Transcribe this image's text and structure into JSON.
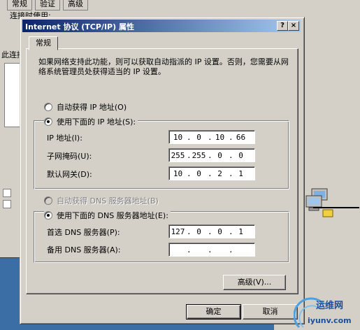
{
  "background_window": {
    "tabs": [
      "常规",
      "验证",
      "高级"
    ],
    "label_connect": "连接时使用:",
    "label_items": "此连接使用下列项目"
  },
  "dialog": {
    "title": "Internet 协议 (TCP/IP) 属性",
    "help_label": "?",
    "close_label": "×",
    "tab_general": "常规",
    "description": "如果网络支持此功能，则可以获取自动指派的 IP 设置。否则，您需要从网络系统管理员处获得适当的 IP 设置。",
    "radio_auto_ip": "自动获得 IP 地址(O)",
    "radio_manual_ip": "使用下面的 IP 地址(S):",
    "ip_label": "IP 地址(I):",
    "mask_label": "子网掩码(U):",
    "gateway_label": "默认网关(D):",
    "ip": [
      "10",
      "0",
      "10",
      "66"
    ],
    "mask": [
      "255",
      "255",
      "0",
      "0"
    ],
    "gateway": [
      "10",
      "0",
      "2",
      "1"
    ],
    "radio_auto_dns": "自动获得 DNS 服务器地址(B)",
    "radio_manual_dns": "使用下面的 DNS 服务器地址(E):",
    "dns1_label": "首选 DNS 服务器(P):",
    "dns2_label": "备用 DNS 服务器(A):",
    "dns1": [
      "127",
      "0",
      "0",
      "1"
    ],
    "dns2": [
      "",
      "",
      "",
      ""
    ],
    "advanced_button": "高级(V)...",
    "ok_button": "确定",
    "cancel_button": "取消"
  },
  "watermark": {
    "name": "运维网",
    "url": "iyunv.com"
  },
  "colors": {
    "face": "#d4d0c8",
    "title_start": "#0a246a",
    "title_end": "#a6caf0",
    "desktop": "#3a6ea5"
  }
}
